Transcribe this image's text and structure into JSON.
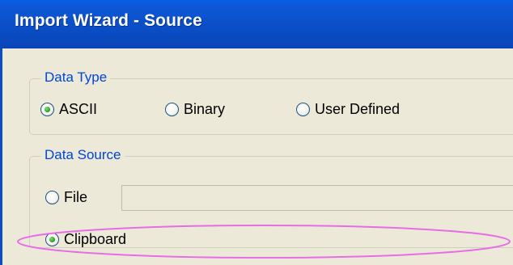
{
  "window": {
    "title": "Import Wizard - Source"
  },
  "data_type": {
    "legend": "Data Type",
    "options": [
      {
        "label": "ASCII",
        "checked": true
      },
      {
        "label": "Binary",
        "checked": false
      },
      {
        "label": "User Defined",
        "checked": false
      }
    ]
  },
  "data_source": {
    "legend": "Data Source",
    "options": [
      {
        "label": "File",
        "checked": false
      },
      {
        "label": "Clipboard",
        "checked": true
      }
    ],
    "file_path_value": ""
  },
  "colors": {
    "legend_text": "#0046d5",
    "highlight_ellipse": "#e86be8",
    "title_bar": "#0a4ec7"
  },
  "annotations": {
    "highlight": "ellipse around Clipboard option"
  }
}
